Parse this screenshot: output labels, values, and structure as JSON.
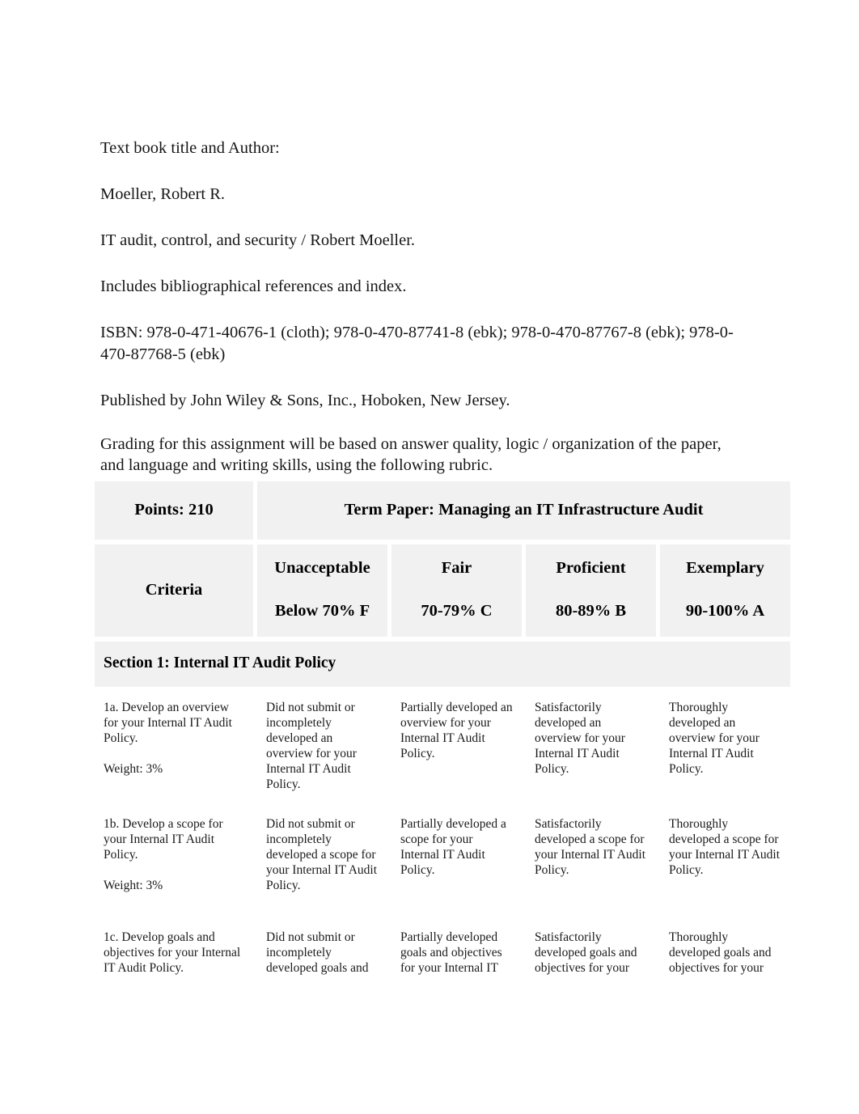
{
  "document": {
    "intro_paragraphs": [
      "Text book title and Author:",
      "Moeller, Robert R.",
      "IT audit, control, and security / Robert Moeller.",
      "Includes bibliographical references and index.",
      "ISBN: 978-0-471-40676-1 (cloth); 978-0-470-87741-8 (ebk); 978-0-470-87767-8 (ebk); 978-0-470-87768-5 (ebk)",
      "Published by John Wiley & Sons, Inc., Hoboken, New Jersey."
    ],
    "grading_note": "Grading for this assignment will be based on answer quality, logic / organization of the paper, and language and writing skills, using the following rubric."
  },
  "rubric": {
    "points_label": "Points: 210",
    "title": "Term Paper: Managing an IT Infrastructure Audit",
    "criteria_header": "Criteria",
    "levels": [
      {
        "name": "Unacceptable",
        "range": "Below 70% F"
      },
      {
        "name": "Fair",
        "range": "70-79% C"
      },
      {
        "name": "Proficient",
        "range": "80-89% B"
      },
      {
        "name": "Exemplary",
        "range": "90-100% A"
      }
    ],
    "sections": [
      {
        "title": "Section 1: Internal IT Audit Policy",
        "rows": [
          {
            "criterion": "1a. Develop an overview for your Internal IT Audit Policy.",
            "weight": "Weight: 3%",
            "unacceptable": "Did not submit or incompletely developed an overview for your Internal IT Audit Policy.",
            "fair": "Partially developed an overview for your Internal IT Audit Policy.",
            "proficient": "Satisfactorily developed an overview for your Internal IT Audit Policy.",
            "exemplary": "Thoroughly developed an overview for your Internal IT Audit Policy."
          },
          {
            "criterion": "1b. Develop a scope for your Internal IT Audit Policy.",
            "weight": "Weight: 3%",
            "unacceptable": "Did not submit or incompletely developed a scope for your Internal IT Audit Policy.",
            "fair": "Partially developed a scope for your Internal IT Audit Policy.",
            "proficient": "Satisfactorily developed a scope for your Internal IT Audit Policy.",
            "exemplary": "Thoroughly developed a scope for your Internal IT Audit Policy."
          },
          {
            "criterion": "1c. Develop goals and objectives for your Internal IT Audit Policy.",
            "weight": "",
            "unacceptable": "Did not submit or incompletely developed goals and",
            "fair": "Partially developed goals and objectives for your Internal IT",
            "proficient": "Satisfactorily developed goals and objectives for your",
            "exemplary": "Thoroughly developed goals and objectives for your"
          }
        ]
      }
    ]
  }
}
